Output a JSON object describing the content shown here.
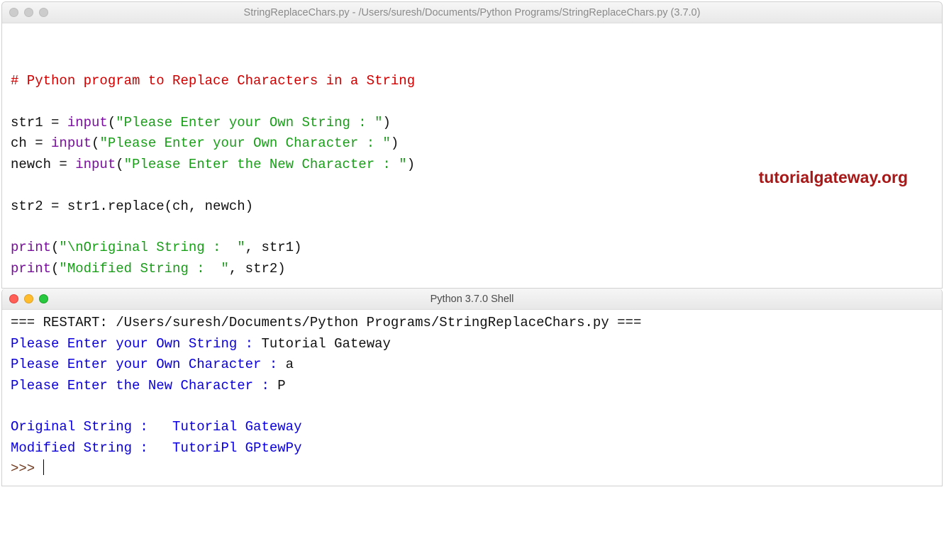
{
  "editor_window": {
    "title": "StringReplaceChars.py - /Users/suresh/Documents/Python Programs/StringReplaceChars.py (3.7.0)",
    "active": false
  },
  "shell_window": {
    "title": "Python 3.7.0 Shell",
    "active": true
  },
  "watermark": "tutorialgateway.org",
  "code": {
    "comment": "# Python program to Replace Characters in a String",
    "l3_a": "str1 = ",
    "l3_b": "input",
    "l3_c": "(",
    "l3_d": "\"Please Enter your Own String : \"",
    "l3_e": ")",
    "l4_a": "ch = ",
    "l4_b": "input",
    "l4_c": "(",
    "l4_d": "\"Please Enter your Own Character : \"",
    "l4_e": ")",
    "l5_a": "newch = ",
    "l5_b": "input",
    "l5_c": "(",
    "l5_d": "\"Please Enter the New Character : \"",
    "l5_e": ")",
    "l7": "str2 = str1.replace(ch, newch)",
    "l9_a": "print",
    "l9_b": "(",
    "l9_c": "\"\\nOriginal String :  \"",
    "l9_d": ", str1)",
    "l10_a": "print",
    "l10_b": "(",
    "l10_c": "\"Modified String :  \"",
    "l10_d": ", str2)"
  },
  "shell": {
    "restart": "=== RESTART: /Users/suresh/Documents/Python Programs/StringReplaceChars.py ===",
    "p1": "Please Enter your Own String : ",
    "i1": "Tutorial Gateway",
    "p2": "Please Enter your Own Character : ",
    "i2": "a",
    "p3": "Please Enter the New Character : ",
    "i3": "P",
    "o1": "Original String :   Tutorial Gateway",
    "o2": "Modified String :   TutoriPl GPtewPy",
    "prompt": ">>> "
  }
}
